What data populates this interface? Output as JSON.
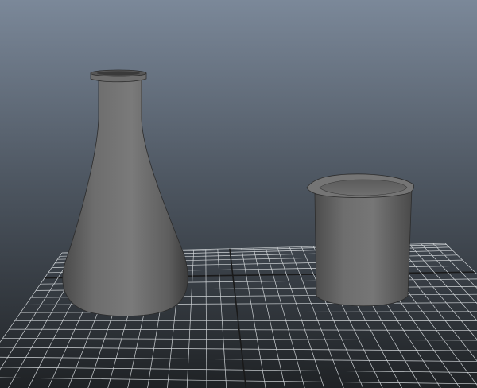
{
  "viewport": {
    "background_top": "#7b8899",
    "background_bottom": "#1c1f22",
    "grid_color": "#cfd3d6",
    "grid_axis_color": "#1a1a1a",
    "object_color": "#6a6a6a"
  },
  "objects": [
    {
      "name": "erlenmeyer-flask",
      "kind": "mesh"
    },
    {
      "name": "beaker",
      "kind": "mesh"
    }
  ],
  "grid": {
    "divisions": 20
  }
}
